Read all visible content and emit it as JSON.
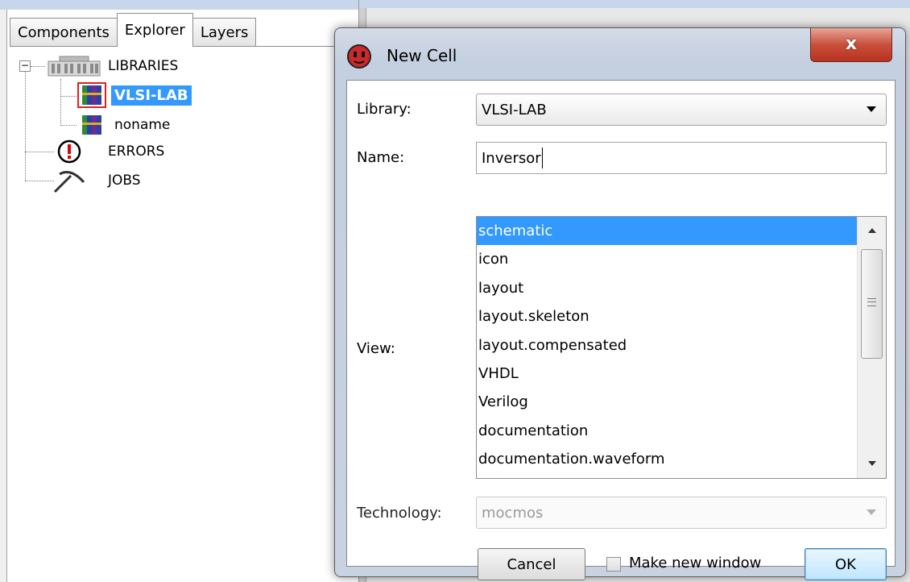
{
  "explorer": {
    "tabs": [
      {
        "label": "Components",
        "active": false
      },
      {
        "label": "Explorer",
        "active": true
      },
      {
        "label": "Layers",
        "active": false
      }
    ],
    "tree": {
      "root_label": "LIBRARIES",
      "libraries": [
        {
          "label": "VLSI-LAB",
          "selected": true
        },
        {
          "label": "noname",
          "selected": false
        }
      ],
      "errors_label": "ERRORS",
      "jobs_label": "JOBS"
    }
  },
  "dialog": {
    "title": "New Cell",
    "close_label": "x",
    "library_label": "Library:",
    "library_value": "VLSI-LAB",
    "name_label": "Name:",
    "name_value": "Inversor",
    "view_label": "View:",
    "views": [
      "schematic",
      "icon",
      "layout",
      "layout.skeleton",
      "layout.compensated",
      "VHDL",
      "Verilog",
      "documentation",
      "documentation.waveform"
    ],
    "selected_view": "schematic",
    "technology_label": "Technology:",
    "technology_value": "mocmos",
    "cancel_label": "Cancel",
    "make_new_window_label": "Make new window",
    "make_new_window_checked": false,
    "ok_label": "OK"
  },
  "colors": {
    "selection": "#3399ff",
    "close_button": "#c8503c",
    "dialog_frame": "#c4cfdf"
  }
}
